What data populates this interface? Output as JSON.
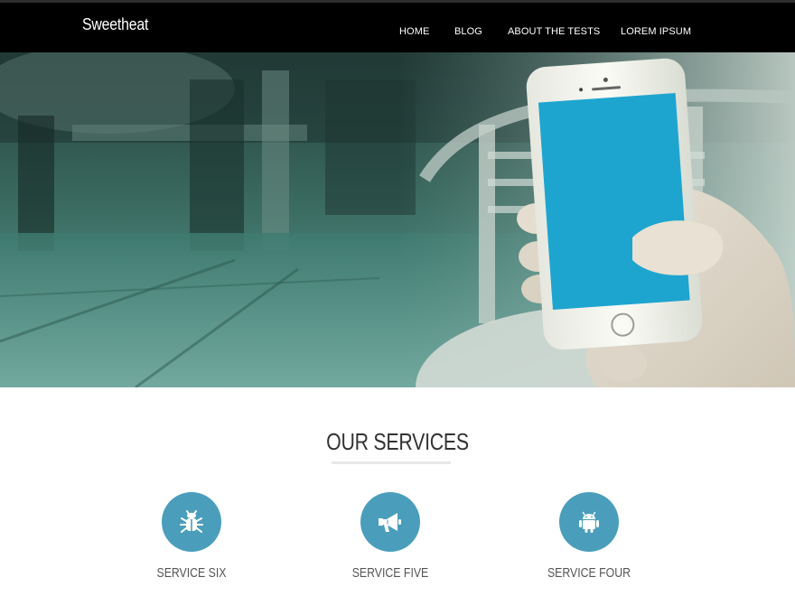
{
  "site": {
    "brand": "Sweetheat"
  },
  "nav": {
    "items": [
      {
        "label": "HOME"
      },
      {
        "label": "BLOG"
      },
      {
        "label": "ABOUT THE TESTS"
      },
      {
        "label": "LOREM IPSUM"
      }
    ]
  },
  "hero": {
    "image": "hand holding smartphone in cafe",
    "screen_color": "#1ea5cf"
  },
  "services": {
    "title": "OUR SERVICES",
    "accent_color": "#4a9ebb",
    "items": [
      {
        "label": "SERVICE SIX",
        "icon": "bug-icon"
      },
      {
        "label": "SERVICE FIVE",
        "icon": "megaphone-icon"
      },
      {
        "label": "SERVICE FOUR",
        "icon": "android-icon"
      }
    ]
  }
}
